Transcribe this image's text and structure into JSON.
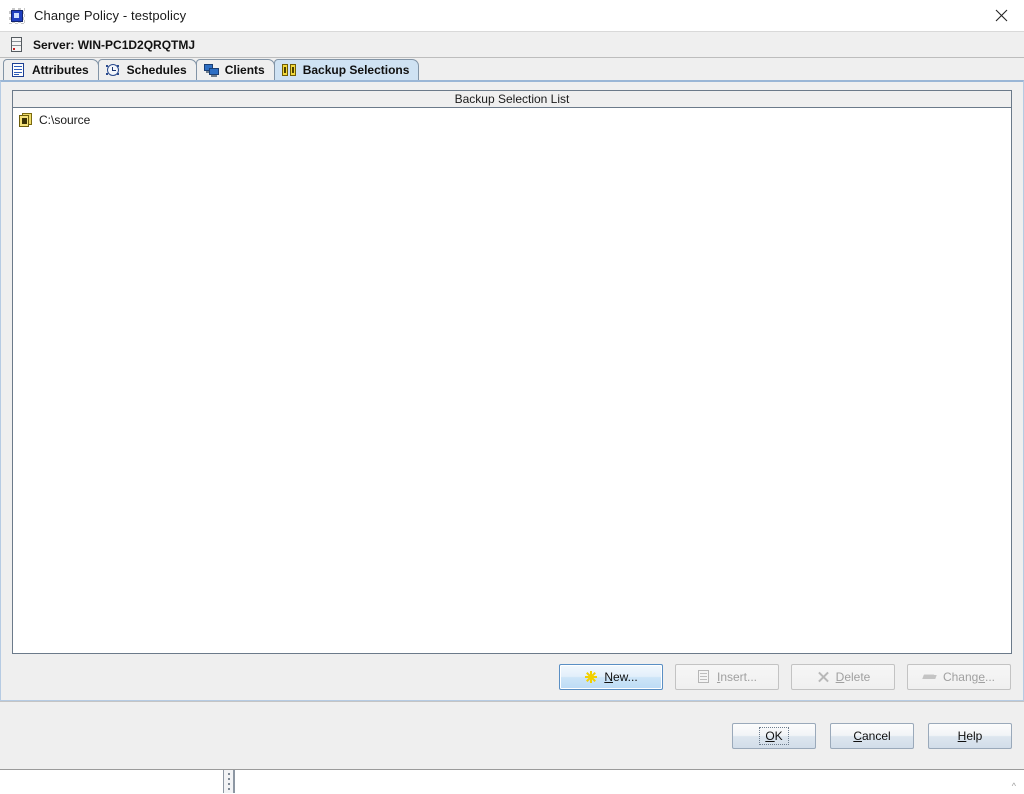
{
  "window": {
    "title": "Change Policy - testpolicy",
    "title_icon": "policy-icon",
    "close_icon": "close-icon"
  },
  "server_bar": {
    "icon": "server-icon",
    "label": "Server: WIN-PC1D2QRQTMJ"
  },
  "tabs": [
    {
      "label": "Attributes",
      "icon": "attributes-icon",
      "active": false
    },
    {
      "label": "Schedules",
      "icon": "clock-icon",
      "active": false
    },
    {
      "label": "Clients",
      "icon": "computer-icon",
      "active": false
    },
    {
      "label": "Backup Selections",
      "icon": "backup-selections-icon",
      "active": true
    }
  ],
  "backup_selections": {
    "list_header": "Backup Selection List",
    "rows": [
      {
        "label": "C:\\source",
        "icon": "folder-document-icon"
      }
    ],
    "buttons": [
      {
        "prefix": "",
        "mnemonic": "N",
        "suffix": "ew...",
        "icon": "starburst-icon",
        "enabled": true,
        "primary": true
      },
      {
        "prefix": "",
        "mnemonic": "I",
        "suffix": "nsert...",
        "icon": "document-icon",
        "enabled": false,
        "primary": false
      },
      {
        "prefix": "",
        "mnemonic": "D",
        "suffix": "elete",
        "icon": "x-icon",
        "enabled": false,
        "primary": false
      },
      {
        "prefix": "Chang",
        "mnemonic": "e",
        "suffix": "...",
        "icon": "change-icon",
        "enabled": false,
        "primary": false
      }
    ]
  },
  "footer": {
    "buttons": [
      {
        "prefix": "",
        "mnemonic": "O",
        "suffix": "K",
        "focused": true
      },
      {
        "prefix": "",
        "mnemonic": "C",
        "suffix": "ancel",
        "focused": false
      },
      {
        "prefix": "",
        "mnemonic": "H",
        "suffix": "elp",
        "focused": false
      }
    ]
  },
  "status_strip": {
    "splitter": "splitter-handle",
    "caret": "^"
  },
  "colors": {
    "active_tab": "#cfe2f3",
    "panel_bg": "#efefef",
    "panel_border": "#b6cbe3",
    "list_border": "#6b7a8a",
    "primary_button_border": "#5a8fc4",
    "accent_yellow": "#f2d000",
    "disabled_text": "#a0a0a0"
  }
}
